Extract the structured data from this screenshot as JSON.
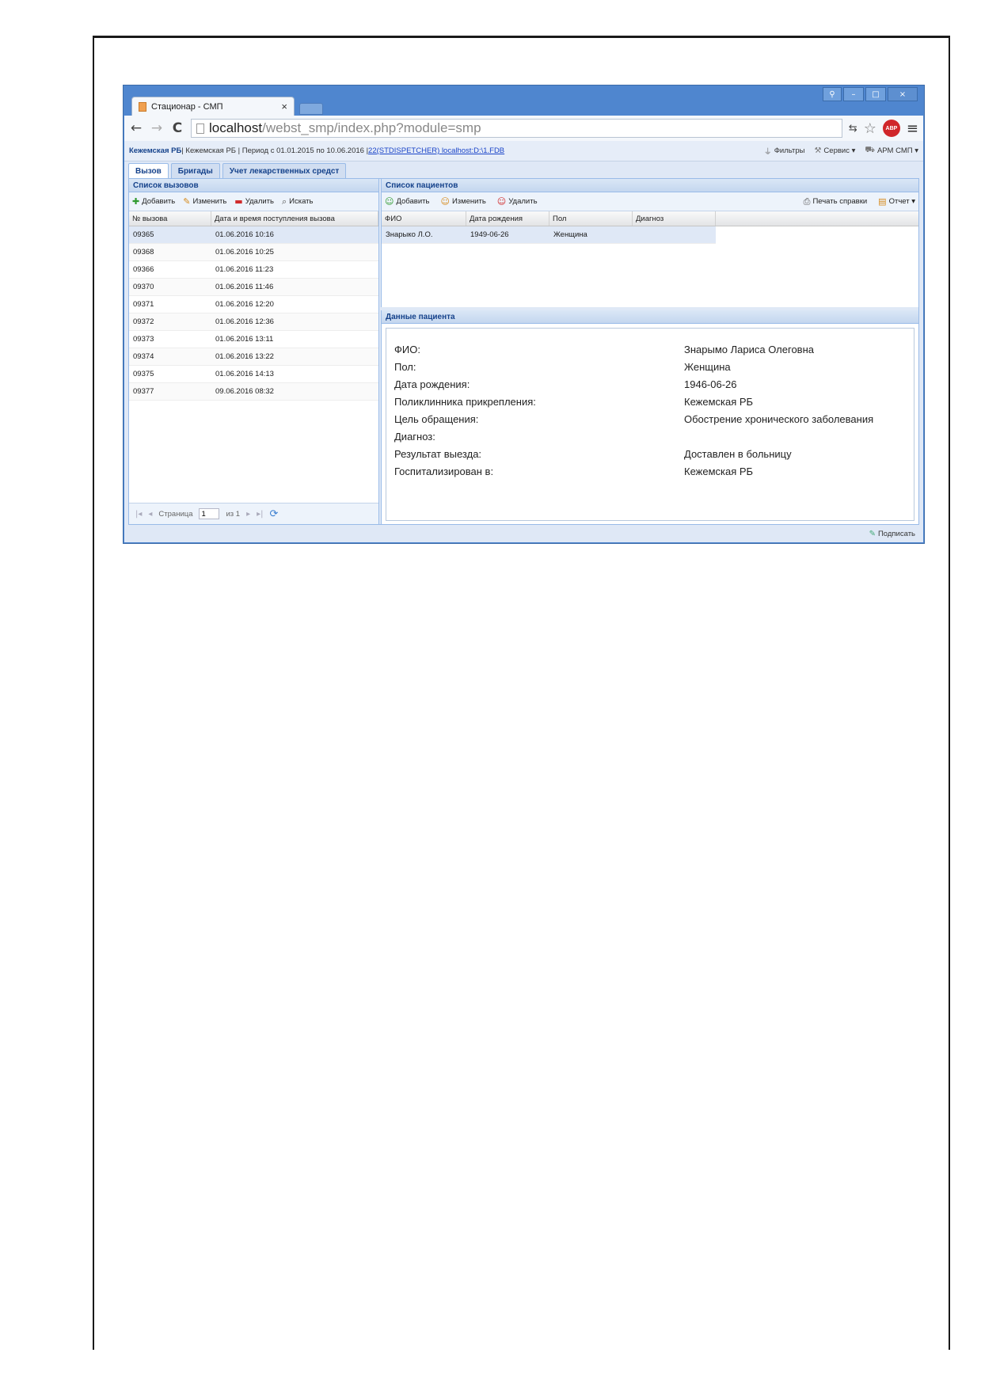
{
  "browser": {
    "tab_title": "Стационар - СМП",
    "tab_close": "×",
    "url_host": "localhost",
    "url_path": "/webst_smp/index.php?module=smp",
    "abp_label": "ABP",
    "window_controls": [
      "⚲",
      "–",
      "□",
      "×"
    ]
  },
  "app_header": {
    "org_bold": "Кежемская РБ",
    "org": " | Кежемская РБ | Период с 01.01.2015 по 10.06.2016 | ",
    "db_link": "22(STDISPETCHER) localhost:D:\\1.FDB",
    "tools": [
      {
        "icon": "filter-icon",
        "glyph": "⏚",
        "label": "Фильтры"
      },
      {
        "icon": "wrench-icon",
        "glyph": "⚒",
        "label": "Сервис ▾"
      },
      {
        "icon": "car-icon",
        "glyph": "⛟",
        "label": "АРМ СМП ▾"
      }
    ]
  },
  "main_tabs": [
    "Вызов",
    "Бригады",
    "Учет лекарственных средст"
  ],
  "calls_panel": {
    "title": "Список вызовов",
    "toolbar": [
      {
        "icon": "add-icon",
        "glyph": "✚",
        "label": "Добавить"
      },
      {
        "icon": "edit-icon",
        "glyph": "✎",
        "label": "Изменить"
      },
      {
        "icon": "delete-icon",
        "glyph": "▬",
        "label": "Удалить"
      },
      {
        "icon": "search-icon",
        "glyph": "⌕",
        "label": "Искать"
      }
    ],
    "columns": [
      "№ вызова",
      "Дата и время поступления вызова"
    ],
    "rows": [
      [
        "09365",
        "01.06.2016 10:16"
      ],
      [
        "09368",
        "01.06.2016 10:25"
      ],
      [
        "09366",
        "01.06.2016 11:23"
      ],
      [
        "09370",
        "01.06.2016 11:46"
      ],
      [
        "09371",
        "01.06.2016 12:20"
      ],
      [
        "09372",
        "01.06.2016 12:36"
      ],
      [
        "09373",
        "01.06.2016 13:11"
      ],
      [
        "09374",
        "01.06.2016 13:22"
      ],
      [
        "09375",
        "01.06.2016 14:13"
      ],
      [
        "09377",
        "09.06.2016 08:32"
      ]
    ],
    "pager": {
      "page_label": "Страница",
      "page_value": "1",
      "of_label": "из 1"
    }
  },
  "patients_panel": {
    "title": "Список пациентов",
    "toolbar": [
      {
        "icon": "add-user-icon",
        "glyph": "☺",
        "label": "Добавить"
      },
      {
        "icon": "edit-user-icon",
        "glyph": "☺",
        "label": "Изменить"
      },
      {
        "icon": "delete-user-icon",
        "glyph": "☺",
        "label": "Удалить"
      }
    ],
    "right_tools": [
      {
        "icon": "print-icon",
        "glyph": "⎙",
        "label": "Печать справки"
      },
      {
        "icon": "report-icon",
        "glyph": "▤",
        "label": "Отчет ▾"
      }
    ],
    "columns": [
      "ФИО",
      "Дата рождения",
      "Пол",
      "Диагноз"
    ],
    "rows": [
      [
        "Знарыко Л.О.",
        "1949-06-26",
        "Женщина",
        ""
      ]
    ]
  },
  "patient_details": {
    "title": "Данные пациента",
    "fields": [
      {
        "label": "ФИО:",
        "value": "Знарымо Лариса Олеговна"
      },
      {
        "label": "Пол:",
        "value": "Женщина"
      },
      {
        "label": "Дата рождения:",
        "value": "1946-06-26"
      },
      {
        "label": "Поликлинника прикрепления:",
        "value": "Кежемская РБ"
      },
      {
        "label": "Цель обращения:",
        "value": "Обострение хронического заболевания"
      },
      {
        "label": "Диагноз:",
        "value": ""
      },
      {
        "label": "Результат выезда:",
        "value": "Доставлен в больницу"
      },
      {
        "label": "Госпитализирован в:",
        "value": "Кежемская РБ"
      }
    ]
  },
  "statusbar": {
    "sign_label": "Подписать"
  }
}
